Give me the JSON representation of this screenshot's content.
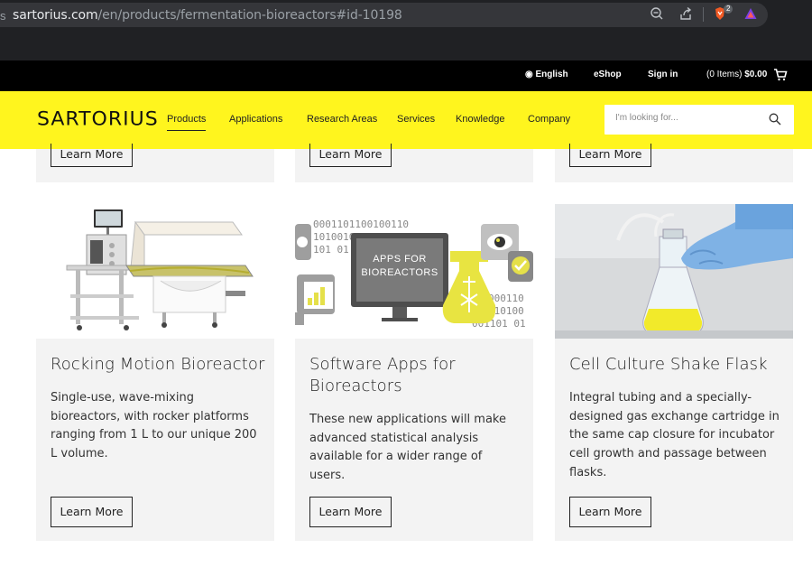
{
  "browser": {
    "url_prefix": "s",
    "url_domain": "sartorius.com",
    "url_path": "/en/products/fermentation-bioreactors#id-10198",
    "brave_badge": "2"
  },
  "topbar": {
    "language": "English",
    "eshop": "eShop",
    "signin": "Sign in",
    "cart": "(0 Items)",
    "cart_total": "$0.00"
  },
  "header": {
    "logo": "SARTORIUS",
    "nav": [
      "Products",
      "Applications",
      "Research Areas",
      "Services",
      "Knowledge",
      "Company"
    ],
    "search_placeholder": "I'm looking for..."
  },
  "cards": [
    {
      "title": "Rocking Motion Bioreactor",
      "description": "Single-use, wave-mixing bioreactors, with rocker platforms ranging from 1 L to our unique 200 L volume.",
      "button": "Learn More"
    },
    {
      "title": "Software Apps for Bioreactors",
      "description": "These new applications will make advanced statistical analysis available for a wider range of users.",
      "button": "Learn More",
      "image_text": "APPS FOR BIOREACTORS",
      "image_binary_1": "0001101100100110",
      "image_binary_2": "10100100",
      "image_binary_3": "101 01",
      "image_binary_4": "000110",
      "image_binary_5": "010100",
      "image_binary_6": "001101 01"
    },
    {
      "title": "Cell Culture Shake Flask",
      "description": "Integral tubing and a specially-designed gas exchange cartridge in the same cap closure for incubator cell growth and passage between flasks.",
      "button": "Learn More"
    }
  ],
  "top_row_buttons": [
    "Learn More",
    "Learn More",
    "Learn More"
  ],
  "colors": {
    "brand_yellow": "#fff51e",
    "card_bg": "#f3f3f3",
    "topbar_bg": "#000000"
  }
}
